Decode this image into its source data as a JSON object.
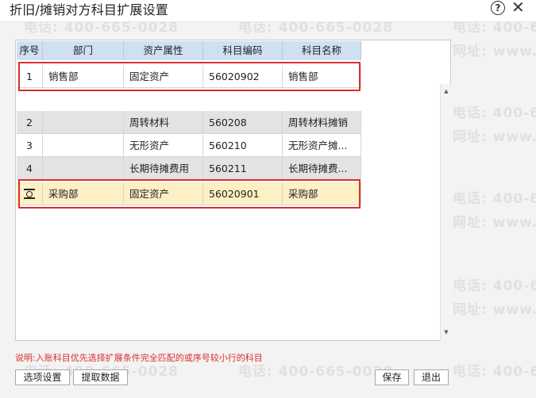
{
  "dialog": {
    "title": "折旧/摊销对方科目扩展设置"
  },
  "grid": {
    "headers": [
      "序号",
      "部门",
      "资产属性",
      "科目编码",
      "科目名称"
    ],
    "rows": [
      {
        "seq": "1",
        "dept": "销售部",
        "attr": "固定资产",
        "code": "56020902",
        "name": "销售部"
      },
      {
        "seq": "2",
        "dept": "",
        "attr": "周转材料",
        "code": "560208",
        "name": "周转材料摊销"
      },
      {
        "seq": "3",
        "dept": "",
        "attr": "无形资产",
        "code": "560210",
        "name": "无形资产摊..."
      },
      {
        "seq": "4",
        "dept": "",
        "attr": "长期待摊费用",
        "code": "560211",
        "name": "长期待摊费..."
      },
      {
        "seq": "",
        "dept": "采购部",
        "attr": "固定资产",
        "code": "56020901",
        "name": "采购部"
      }
    ]
  },
  "watermark": {
    "phone": "电话: 400-665-0028",
    "site": "网址: www.chanjet.net"
  },
  "note": "说明:入账科目优先选择扩展条件完全匹配的或序号较小行的科目",
  "buttons": {
    "options": "选项设置",
    "fetch": "提取数据",
    "save": "保存",
    "exit": "退出"
  },
  "colors": {
    "highlight_border": "#d9302f",
    "header_bg": "#cfe0f3",
    "active_row_bg": "#fdf0c4",
    "note_text": "#d9302f"
  }
}
